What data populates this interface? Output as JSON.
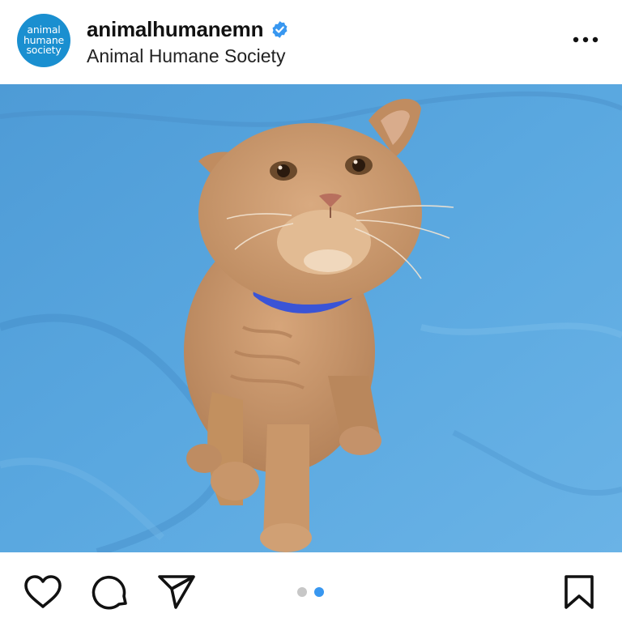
{
  "account": {
    "avatar_text": [
      "animal",
      "humane",
      "society"
    ],
    "username": "animalhumanemn",
    "display_name": "Animal Humane Society",
    "verified": true
  },
  "post": {
    "image_subject": "orange tabby cat on blue backdrop",
    "carousel": {
      "total": 2,
      "active_index": 1
    }
  },
  "icons": {
    "more": "more-horizontal-icon",
    "like": "heart-icon",
    "comment": "comment-icon",
    "share": "paper-plane-icon",
    "save": "bookmark-icon",
    "verified": "verified-badge-icon"
  },
  "colors": {
    "avatar_bg": "#1a8fd0",
    "verified": "#3897f0",
    "dot_active": "#3897f0",
    "dot_inactive": "#c7c7c7",
    "backdrop": "#5aa6dc"
  }
}
